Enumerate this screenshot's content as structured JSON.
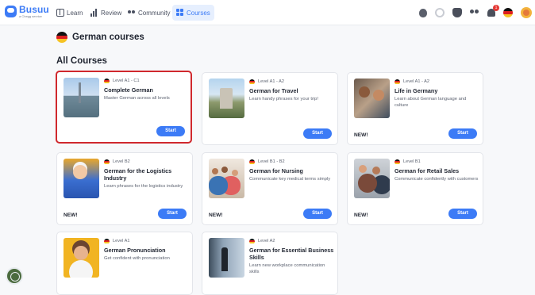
{
  "brand": {
    "name": "Busuu",
    "tagline": "a Chegg service",
    "accent": "#3c7bf6"
  },
  "nav": {
    "learn": "Learn",
    "review": "Review",
    "community": "Community",
    "courses": "Courses"
  },
  "header_icons": {
    "notifications_count": "1"
  },
  "page": {
    "title": "German courses",
    "section": "All Courses"
  },
  "courses": [
    {
      "level": "Level A1 - C1",
      "title": "Complete German",
      "desc": "Master German across all levels",
      "new": "",
      "button": "Start"
    },
    {
      "level": "Level A1 - A2",
      "title": "German for Travel",
      "desc": "Learn handy phrases for your trip!",
      "new": "",
      "button": "Start"
    },
    {
      "level": "Level A1 - A2",
      "title": "Life in Germany",
      "desc": "Learn about German language and culture",
      "new": "NEW!",
      "button": "Start"
    },
    {
      "level": "Level B2",
      "title": "German for the Logistics Industry",
      "desc": "Learn phrases for the logistics industry",
      "new": "NEW!",
      "button": "Start"
    },
    {
      "level": "Level B1 - B2",
      "title": "German for Nursing",
      "desc": "Communicate key medical terms simply",
      "new": "NEW!",
      "button": "Start"
    },
    {
      "level": "Level B1",
      "title": "German for Retail Sales",
      "desc": "Communicate confidently with customers",
      "new": "NEW!",
      "button": "Start"
    },
    {
      "level": "Level A1",
      "title": "German Pronunciation",
      "desc": "Get confident with pronunciation",
      "new": "",
      "button": ""
    },
    {
      "level": "Level A2",
      "title": "German for Essential Business Skills",
      "desc": "Learn new workplace communication skills",
      "new": "",
      "button": ""
    }
  ]
}
